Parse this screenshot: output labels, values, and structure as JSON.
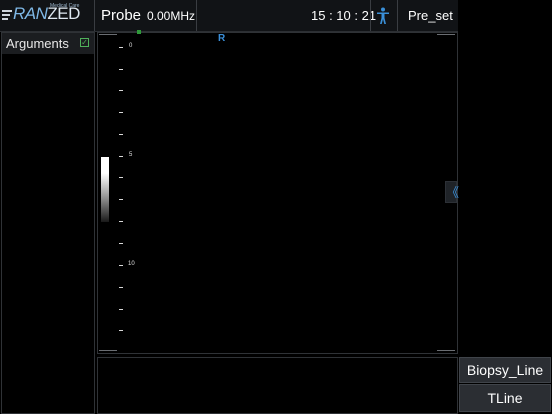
{
  "topbar": {
    "logo_main": "RAN",
    "logo_accent": "ZED",
    "logo_sub": "Medical Care",
    "probe_label": "Probe",
    "frequency": "0.00MHz",
    "time": "15 : 10 : 21",
    "preset_label": "Pre_set",
    "person_icon": "person-icon"
  },
  "left_panel": {
    "title": "Arguments",
    "checkbox_icon": "check-icon",
    "checked": true
  },
  "image": {
    "orientation_marker": "R",
    "depth_labels": [
      "0",
      "5",
      "10"
    ],
    "collapse_glyph": "《",
    "colors": {
      "accent": "#3a8fd8",
      "marker_green": "#2f9a3a"
    }
  },
  "side_buttons": {
    "biopsy_line": "Biopsy_Line",
    "tline": "TLine"
  }
}
